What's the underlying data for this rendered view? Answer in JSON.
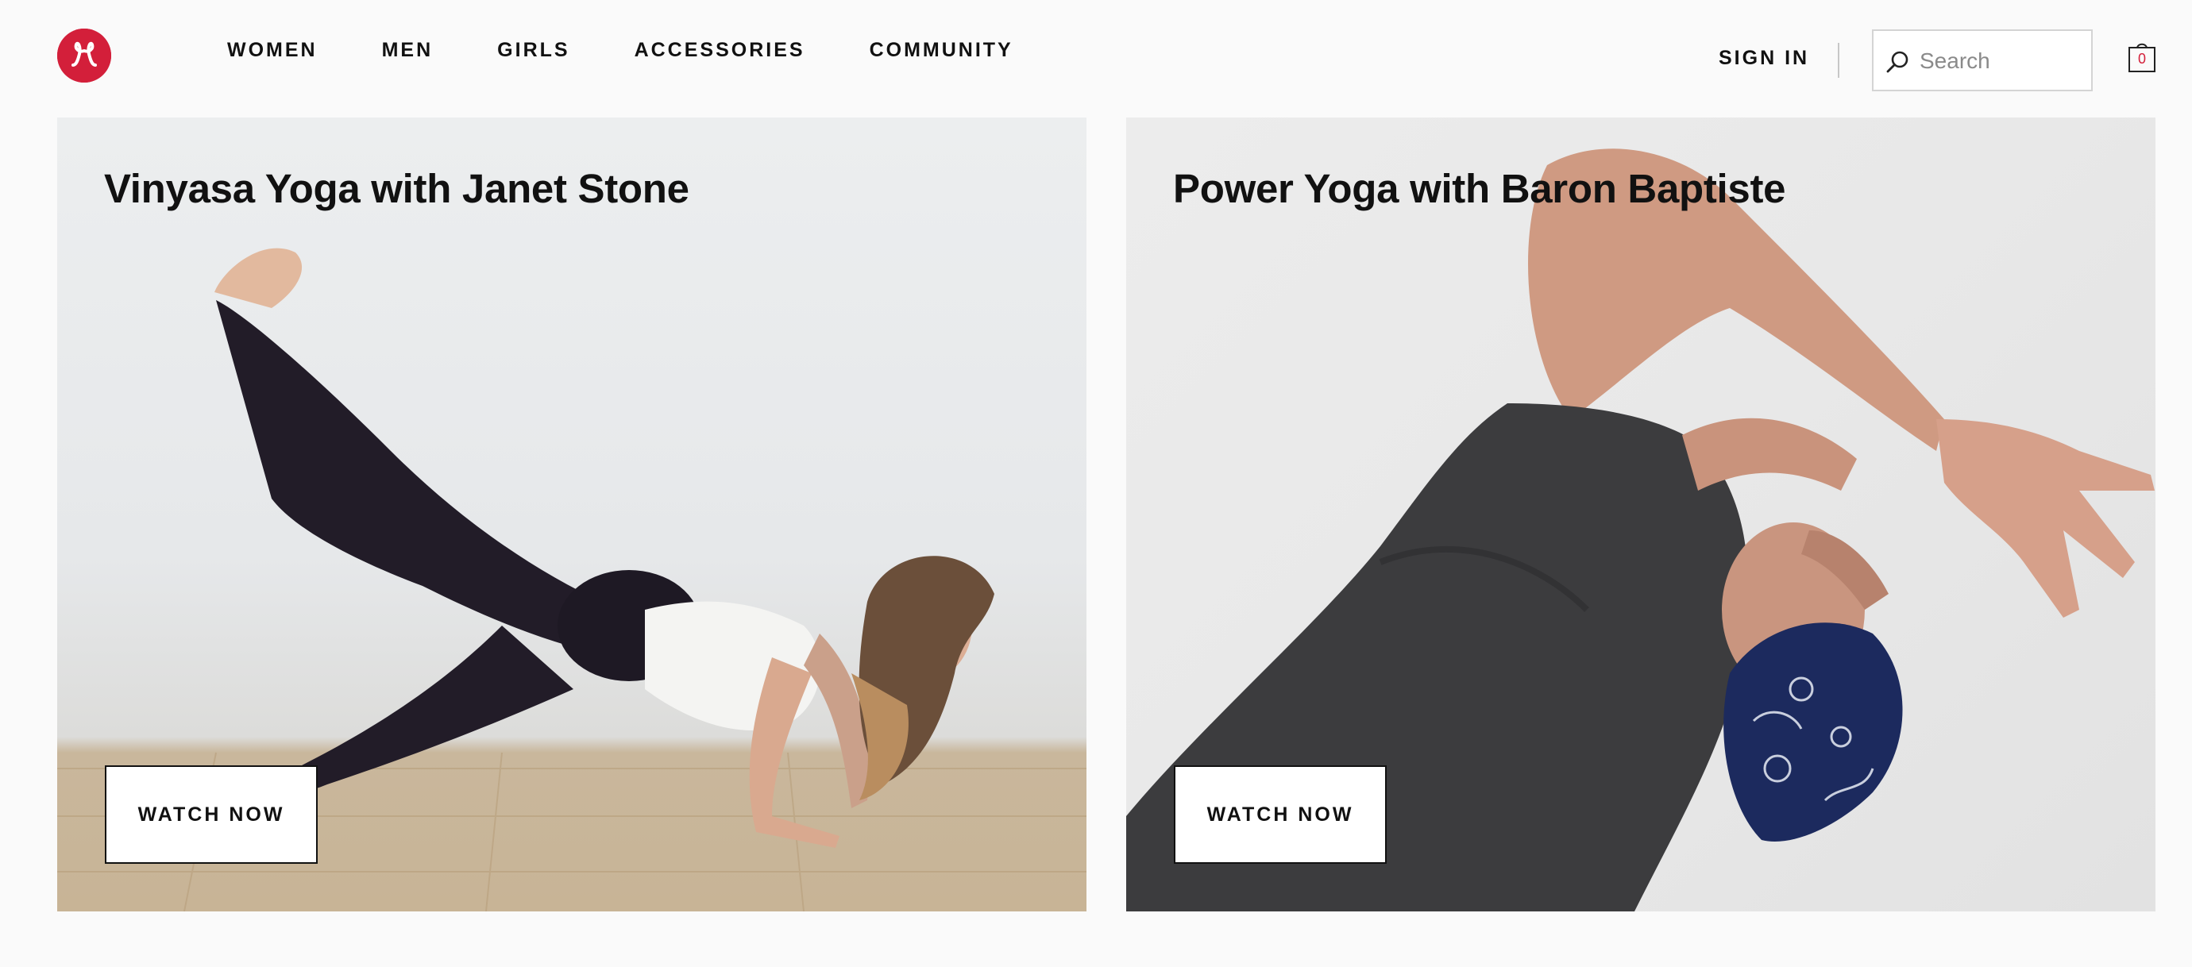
{
  "brand": {
    "logo_icon": "lululemon-logo-icon",
    "color": "#d31f3a"
  },
  "nav": {
    "items": [
      {
        "label": "WOMEN"
      },
      {
        "label": "MEN"
      },
      {
        "label": "GIRLS"
      },
      {
        "label": "ACCESSORIES"
      },
      {
        "label": "COMMUNITY"
      }
    ]
  },
  "account": {
    "sign_in_label": "SIGN IN"
  },
  "search": {
    "placeholder": "Search",
    "value": "",
    "icon": "search-icon"
  },
  "cart": {
    "count": "0",
    "icon": "shopping-bag-icon"
  },
  "cards": [
    {
      "title": "Vinyasa Yoga with Janet Stone",
      "button_label": "WATCH NOW"
    },
    {
      "title": "Power Yoga with Baron Baptiste",
      "button_label": "WATCH NOW"
    }
  ]
}
